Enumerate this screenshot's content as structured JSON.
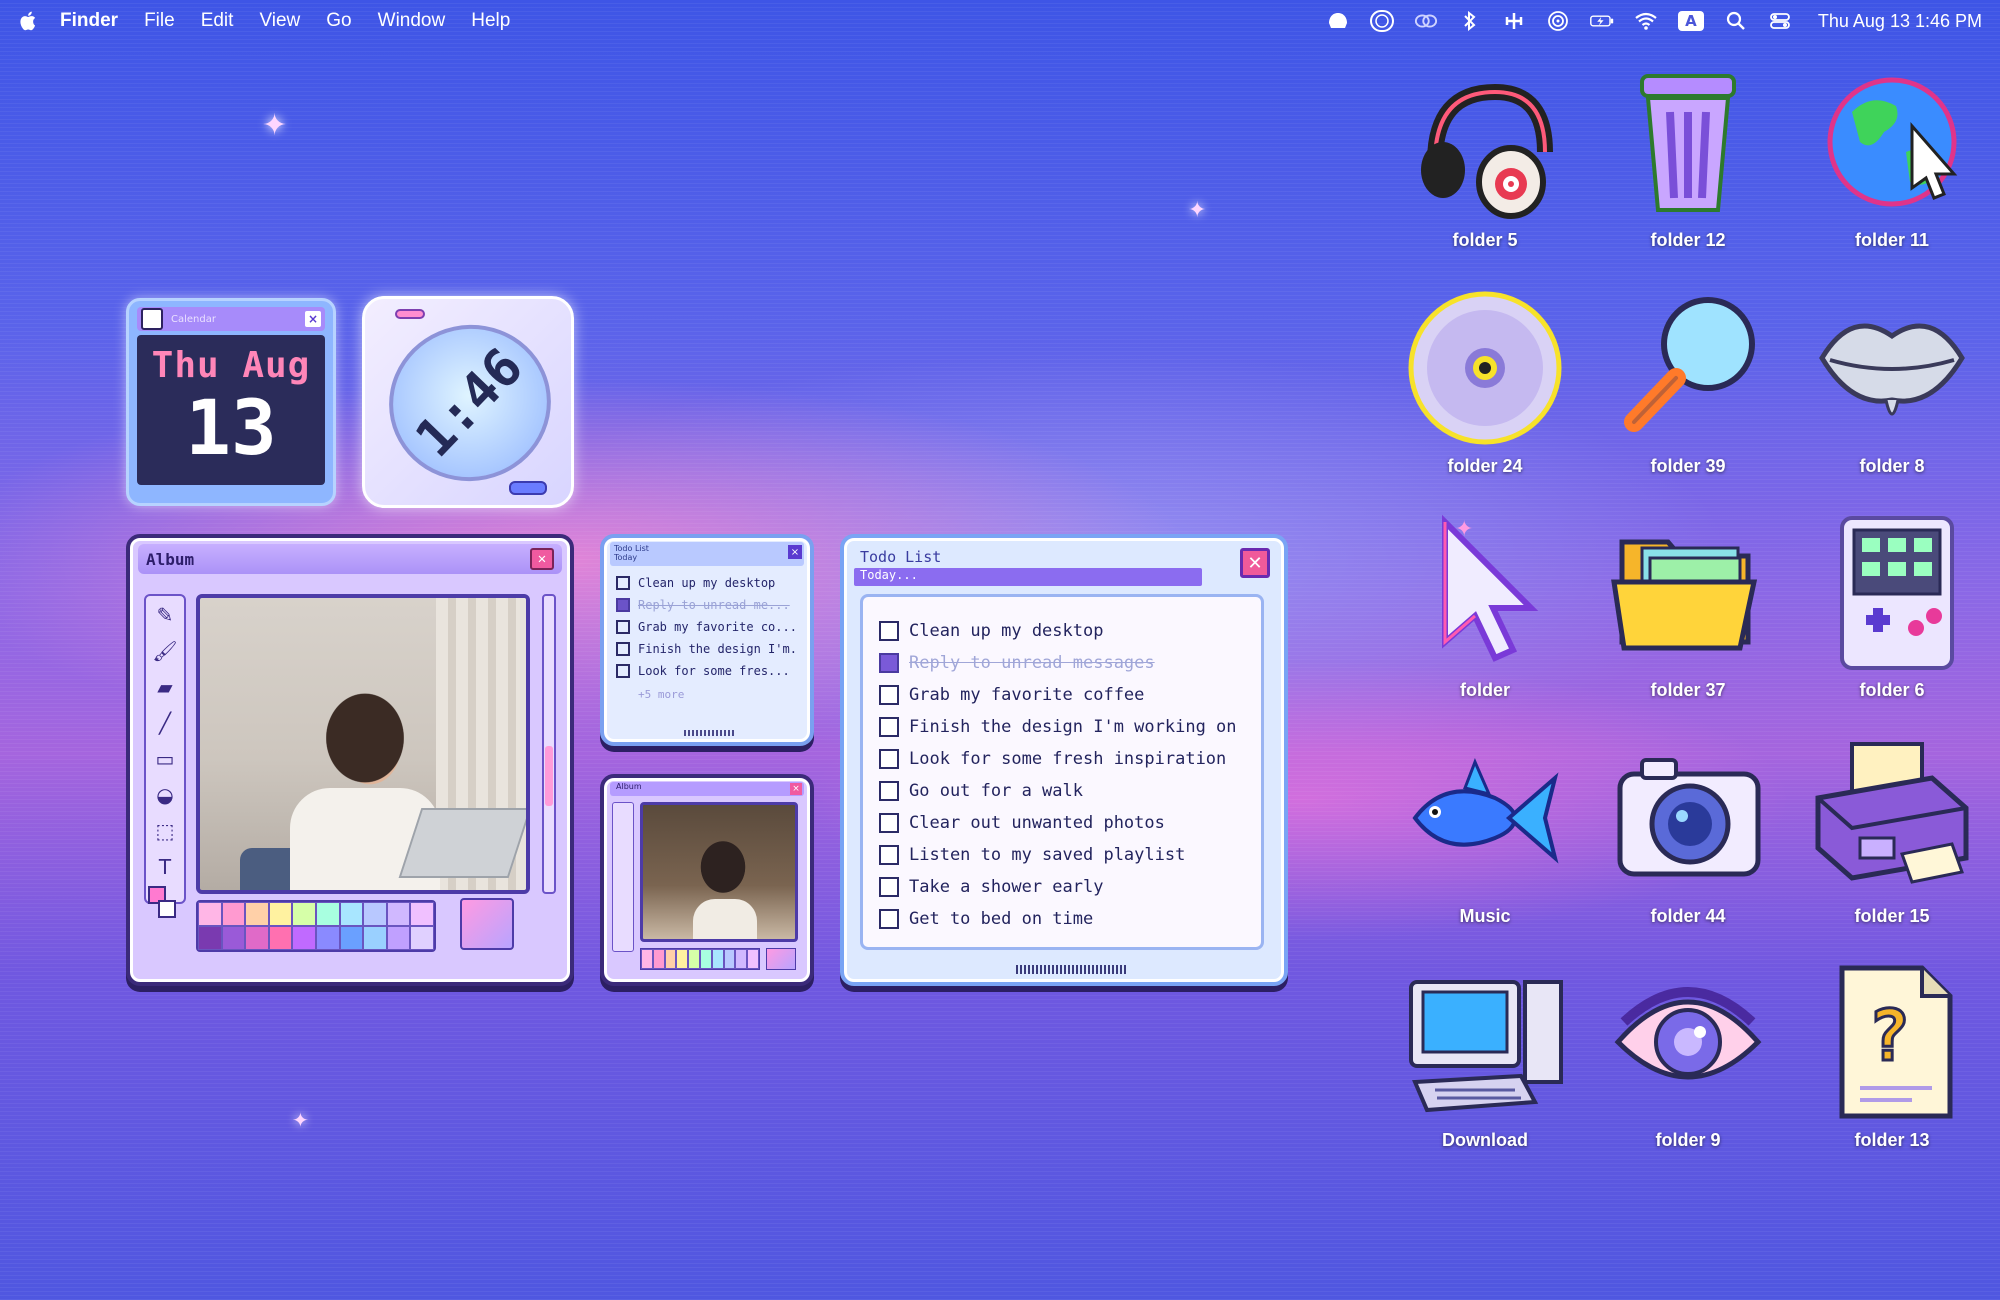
{
  "menubar": {
    "app": "Finder",
    "items": [
      "File",
      "Edit",
      "View",
      "Go",
      "Window",
      "Help"
    ],
    "clock": "Thu Aug 13  1:46 PM",
    "input_source": "A"
  },
  "calendar_widget": {
    "title": "Calendar",
    "day_month": "Thu Aug",
    "day_number": "13"
  },
  "clock_widget": {
    "time": "1:46"
  },
  "album_window": {
    "title": "Album",
    "tools": [
      "pencil",
      "brush",
      "eraser",
      "line",
      "rectangle",
      "fill",
      "select",
      "text"
    ],
    "text_tool_glyph": "T"
  },
  "todo_small": {
    "title": "Todo List",
    "subtitle": "Today",
    "items": [
      {
        "text": "Clean up my desktop",
        "done": false
      },
      {
        "text": "Reply to unread me...",
        "done": true
      },
      {
        "text": "Grab my favorite co...",
        "done": false
      },
      {
        "text": "Finish the design I'm...",
        "done": false
      },
      {
        "text": "Look for some fres...",
        "done": false
      }
    ],
    "more": "+5 more"
  },
  "album_small": {
    "title": "Album"
  },
  "todo_big": {
    "title": "Todo List",
    "subtitle": "Today...",
    "items": [
      {
        "text": "Clean up my desktop",
        "done": false
      },
      {
        "text": "Reply to unread messages",
        "done": true
      },
      {
        "text": "Grab my favorite coffee",
        "done": false
      },
      {
        "text": "Finish the design I'm working on",
        "done": false
      },
      {
        "text": "Look for some fresh inspiration",
        "done": false
      },
      {
        "text": "Go out for a walk",
        "done": false
      },
      {
        "text": "Clear out unwanted photos",
        "done": false
      },
      {
        "text": "Listen to my saved playlist",
        "done": false
      },
      {
        "text": "Take a shower early",
        "done": false
      },
      {
        "text": "Get to bed on time",
        "done": false
      }
    ]
  },
  "desktop_icons": [
    {
      "label": "folder 5",
      "icon": "headphones-icon"
    },
    {
      "label": "folder 12",
      "icon": "trash-icon"
    },
    {
      "label": "folder 11",
      "icon": "globe-icon"
    },
    {
      "label": "folder 24",
      "icon": "cd-icon"
    },
    {
      "label": "folder 39",
      "icon": "magnifier-icon"
    },
    {
      "label": "folder 8",
      "icon": "lips-icon"
    },
    {
      "label": "folder",
      "icon": "cursor-icon"
    },
    {
      "label": "folder 37",
      "icon": "open-folder-icon"
    },
    {
      "label": "folder 6",
      "icon": "gameboy-icon"
    },
    {
      "label": "Music",
      "icon": "goldfish-icon"
    },
    {
      "label": "folder 44",
      "icon": "camera-icon"
    },
    {
      "label": "folder 15",
      "icon": "printer-icon"
    },
    {
      "label": "Download",
      "icon": "computer-icon"
    },
    {
      "label": "folder 9",
      "icon": "eye-icon"
    },
    {
      "label": "folder 13",
      "icon": "unknown-file-icon"
    }
  ],
  "colors": {
    "accent_purple": "#8b6cf0",
    "accent_pink": "#f05a9a",
    "window_frame": "#3b2a7a"
  }
}
